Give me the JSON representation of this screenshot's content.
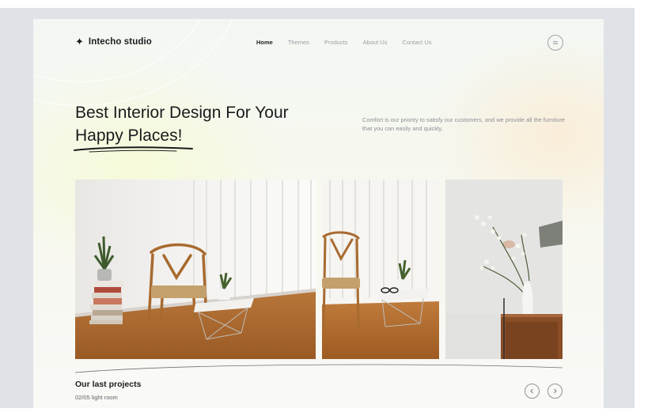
{
  "brand": {
    "name": "Intecho studio",
    "icon": "sparkle-icon"
  },
  "nav": {
    "items": [
      {
        "label": "Home",
        "active": true
      },
      {
        "label": "Themes",
        "active": false
      },
      {
        "label": "Products",
        "active": false
      },
      {
        "label": "About Us",
        "active": false
      },
      {
        "label": "Contact Us",
        "active": false
      }
    ],
    "menu_icon": "menu-icon"
  },
  "hero": {
    "headline_line1": "Best Interior Design For Your",
    "headline_line2": "Happy Places!",
    "intro": "Comfort is our priority to satisfy our customers, and we provide all the furniture that you can easily and quickly."
  },
  "gallery": {
    "images": [
      {
        "subject": "wishbone chair, book stack with snake plant, small side table"
      },
      {
        "subject": "chair and side table with plant and glasses"
      },
      {
        "subject": "hand holding flowering branch into white vase on wooden cabinet"
      }
    ]
  },
  "projects": {
    "title": "Our last projects",
    "counter": "02/05",
    "room": "light room",
    "prev_icon": "chevron-left-icon",
    "next_icon": "chevron-right-icon"
  },
  "colors": {
    "background": "#dfe2e7",
    "text_dark": "#1d1d1f",
    "text_muted": "#8b9096",
    "floor": "#b06a2c"
  }
}
